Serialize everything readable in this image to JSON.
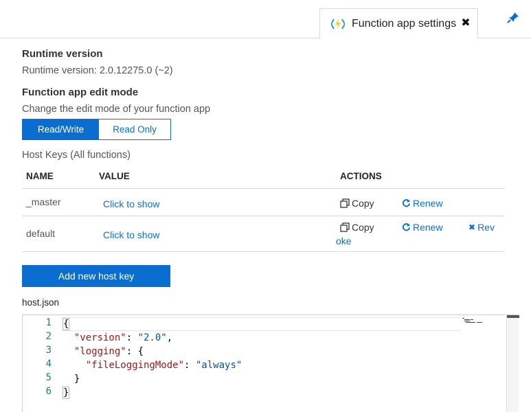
{
  "tab": {
    "title": "Function app settings"
  },
  "runtime": {
    "heading": "Runtime version",
    "text": "Runtime version: 2.0.12275.0 (~2)"
  },
  "edit_mode": {
    "heading": "Function app edit mode",
    "description": "Change the edit mode of your function app",
    "options": [
      "Read/Write",
      "Read Only"
    ],
    "selected": "Read/Write"
  },
  "host_keys": {
    "heading": "Host Keys (All functions)",
    "columns": [
      "NAME",
      "VALUE",
      "ACTIONS"
    ],
    "rows": [
      {
        "name": "_master",
        "value": "Click to show",
        "copy": "Copy",
        "renew": "Renew"
      },
      {
        "name": "default",
        "value": "Click to show",
        "copy": "Copy",
        "renew": "Renew",
        "revoke_part1": "Rev",
        "revoke_part2": "oke"
      }
    ],
    "add_button": "Add new host key"
  },
  "host_json": {
    "label": "host.json",
    "line_numbers": [
      "1",
      "2",
      "3",
      "4",
      "5",
      "6"
    ]
  },
  "colors": {
    "accent": "#0a6ed1",
    "json_key": "#a31515",
    "json_string": "#0451a5",
    "line_number": "#237893"
  }
}
